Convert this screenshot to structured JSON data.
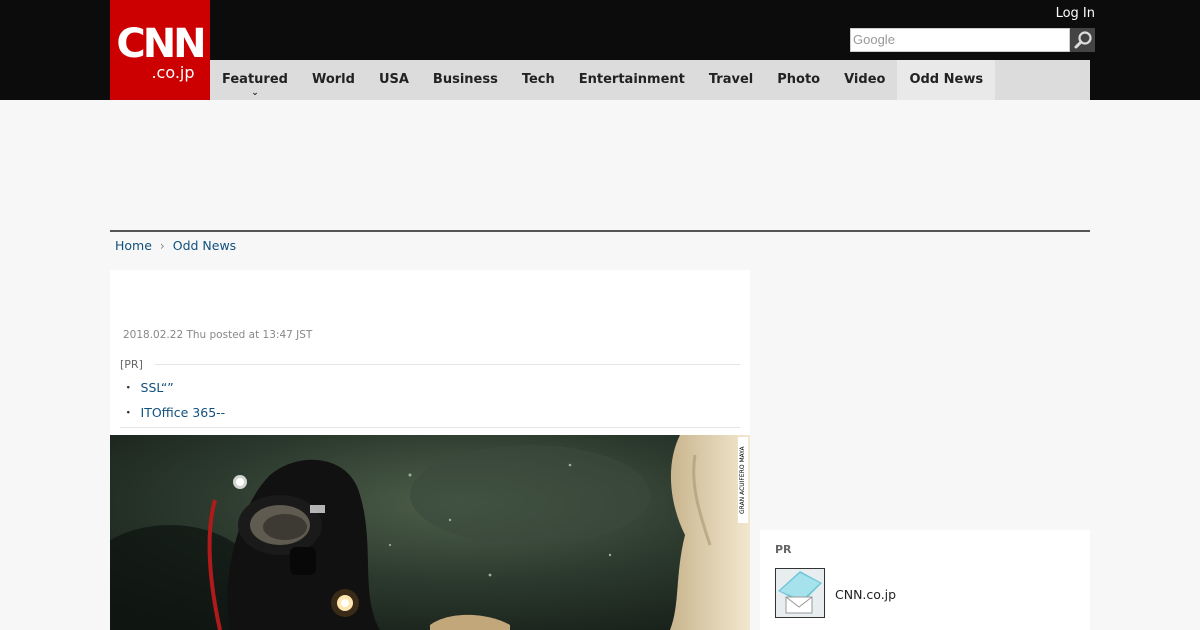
{
  "header": {
    "logo_main": "CNN",
    "logo_sub": ".co.jp",
    "login_label": "Log In",
    "search_placeholder": "Google",
    "search_icon": "magnifier-icon"
  },
  "nav": {
    "items": [
      {
        "label": "Featured"
      },
      {
        "label": "World"
      },
      {
        "label": "USA"
      },
      {
        "label": "Business"
      },
      {
        "label": "Tech"
      },
      {
        "label": "Entertainment"
      },
      {
        "label": "Travel"
      },
      {
        "label": "Photo"
      },
      {
        "label": "Video"
      },
      {
        "label": "Odd News"
      }
    ],
    "active": "Odd News"
  },
  "breadcrumb": {
    "items": [
      {
        "label": "Home"
      },
      {
        "label": "Odd News"
      }
    ]
  },
  "article": {
    "posted": "2018.02.22 Thu posted at 13:47 JST",
    "pr_label": "[PR]",
    "pr_links": [
      {
        "label": "SSL“”"
      },
      {
        "label": "ITOffice 365--"
      }
    ],
    "photo_credit": "GRAN ACUIFERO MAYA"
  },
  "sidebar": {
    "pr_label": "PR",
    "pr_item_name": "CNN.co.jp"
  },
  "colors": {
    "brand_red": "#cc0000",
    "link_blue": "#11507d",
    "topbar": "#0c0c0c",
    "nav_bg": "#dcdcdc"
  }
}
